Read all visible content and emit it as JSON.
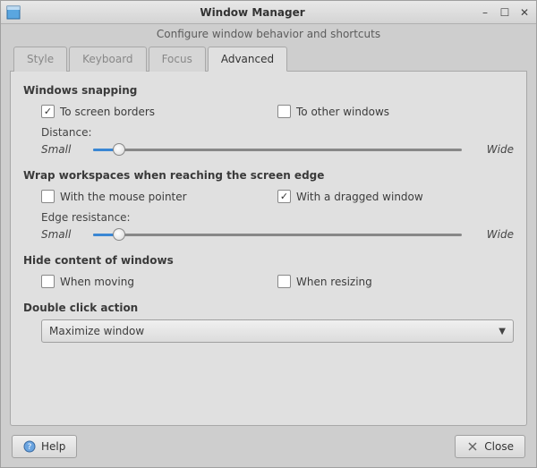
{
  "window": {
    "title": "Window Manager",
    "subtitle": "Configure window behavior and shortcuts"
  },
  "tabs": {
    "style": "Style",
    "keyboard": "Keyboard",
    "focus": "Focus",
    "advanced": "Advanced",
    "active": "advanced"
  },
  "sections": {
    "snapping": {
      "title": "Windows snapping",
      "to_screen_borders": "To screen borders",
      "to_other_windows": "To other windows",
      "distance_label": "Distance:",
      "small": "Small",
      "wide": "Wide",
      "value_pct": 7
    },
    "wrap": {
      "title": "Wrap workspaces when reaching the screen edge",
      "mouse_pointer": "With the mouse pointer",
      "dragged_window": "With a dragged window",
      "edge_resistance_label": "Edge resistance:",
      "small": "Small",
      "wide": "Wide",
      "value_pct": 7
    },
    "hide": {
      "title": "Hide content of windows",
      "when_moving": "When moving",
      "when_resizing": "When resizing"
    },
    "dblclick": {
      "title": "Double click action",
      "selected": "Maximize window"
    }
  },
  "footer": {
    "help": "Help",
    "close": "Close"
  }
}
